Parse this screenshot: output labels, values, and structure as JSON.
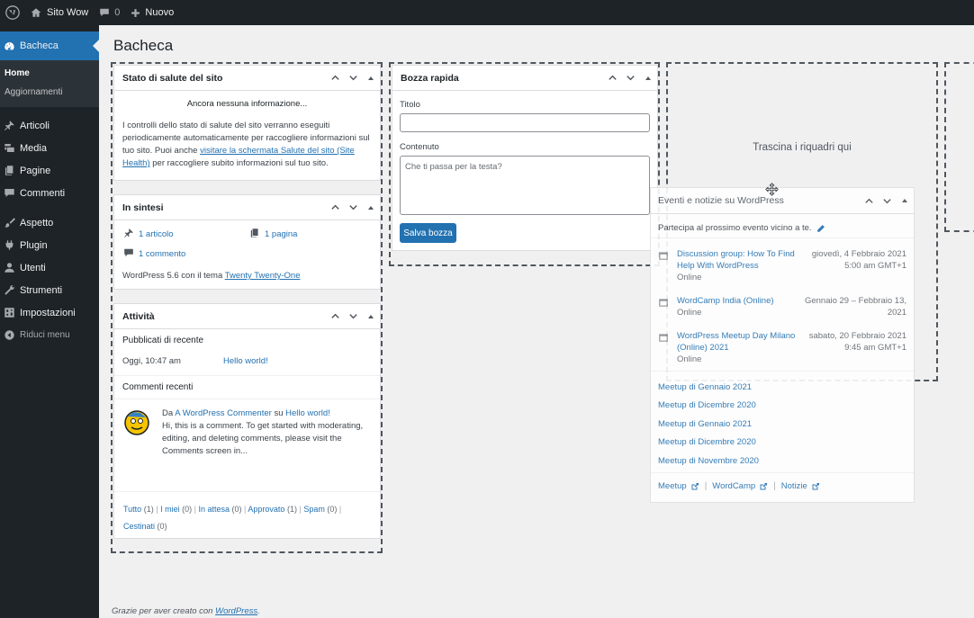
{
  "adminbar": {
    "site_name": "Sito Wow",
    "comments_count": "0",
    "new_label": "Nuovo"
  },
  "sidebar": {
    "current": "Bacheca",
    "submenu": [
      "Home",
      "Aggiornamenti"
    ],
    "items": [
      "Articoli",
      "Media",
      "Pagine",
      "Commenti",
      "Aspetto",
      "Plugin",
      "Utenti",
      "Strumenti",
      "Impostazioni"
    ],
    "collapse": "Riduci menu"
  },
  "page_title": "Bacheca",
  "site_health": {
    "title": "Stato di salute del sito",
    "empty": "Ancora nessuna informazione...",
    "text_1": "I controlli dello stato di salute del sito verranno eseguiti periodicamente automaticamente per raccogliere informazioni sul tuo sito. Puoi anche",
    "link": "visitare la schermata Salute del sito (Site Health)",
    "text_2": "per raccogliere subito informazioni sul tuo sito."
  },
  "glance": {
    "title": "In sintesi",
    "posts": "1 articolo",
    "pages": "1 pagina",
    "comments": "1 commento",
    "theme_text": "WordPress 5.6 con il tema",
    "theme_link": "Twenty Twenty-One"
  },
  "activity": {
    "title": "Attività",
    "recent_label": "Pubblicati di recente",
    "recent_date": "Oggi, 10:47 am",
    "recent_post": "Hello world!",
    "comments_label": "Commenti recenti",
    "comment_from": "Da",
    "comment_author": "A WordPress Commenter",
    "comment_on": "su",
    "comment_post": "Hello world!",
    "comment_text": "Hi, this is a comment. To get started with moderating, editing, and deleting comments, please visit the Comments screen in...",
    "filters": [
      {
        "label": "Tutto",
        "count": "(1)"
      },
      {
        "label": "I miei",
        "count": "(0)"
      },
      {
        "label": "In attesa",
        "count": "(0)"
      },
      {
        "label": "Approvato",
        "count": "(1)"
      },
      {
        "label": "Spam",
        "count": "(0)"
      },
      {
        "label": "Cestinati",
        "count": "(0)"
      }
    ]
  },
  "quick_draft": {
    "title": "Bozza rapida",
    "title_label": "Titolo",
    "content_label": "Contenuto",
    "content_placeholder": "Che ti passa per la testa?",
    "save": "Salva bozza"
  },
  "drop_zone": {
    "text": "Trascina i riquadri qui"
  },
  "events": {
    "title": "Eventi e notizie su WordPress",
    "intro": "Partecipa al prossimo evento vicino a te.",
    "items": [
      {
        "title": "Discussion group: How To Find Help With WordPress",
        "location": "Online",
        "date": "giovedì, 4 Febbraio 2021",
        "time": "5:00 am GMT+1"
      },
      {
        "title": "WordCamp India (Online)",
        "location": "Online",
        "date": "Gennaio 29 – Febbraio 13,",
        "time": "2021"
      },
      {
        "title": "WordPress Meetup Day Milano (Online) 2021",
        "location": "Online",
        "date": "sabato, 20 Febbraio 2021",
        "time": "9:45 am GMT+1"
      }
    ],
    "news": [
      "Meetup di Gennaio 2021",
      "Meetup di Dicembre 2020",
      "Meetup di Gennaio 2021",
      "Meetup di Dicembre 2020",
      "Meetup di Novembre 2020"
    ],
    "footer": [
      "Meetup",
      "WordCamp",
      "Notizie"
    ]
  },
  "footer": {
    "text": "Grazie per aver creato con",
    "link": "WordPress",
    "end": "."
  }
}
